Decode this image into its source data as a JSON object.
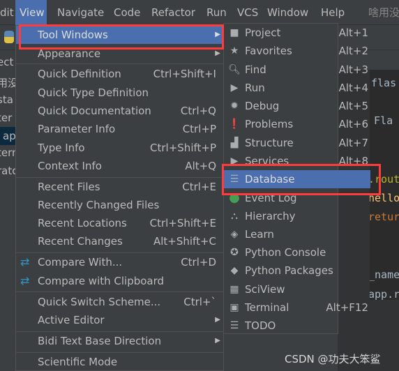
{
  "menubar": {
    "items": [
      {
        "label": "dit"
      },
      {
        "label": "View"
      },
      {
        "label": "Navigate"
      },
      {
        "label": "Code"
      },
      {
        "label": "Refactor"
      },
      {
        "label": "Run"
      },
      {
        "label": "VCS"
      },
      {
        "label": "Window"
      },
      {
        "label": "Help"
      },
      {
        "label": "啥用没"
      }
    ]
  },
  "left_panel": {
    "lines": [
      "ect",
      "用没",
      "sta",
      "ter",
      "ap",
      "tern",
      "rato"
    ]
  },
  "code": {
    "lines": [
      "flas",
      "= Fla",
      ".rout",
      "hello",
      "retur",
      "_name",
      "app.r"
    ]
  },
  "view_menu": {
    "items": [
      {
        "label": "Tool Windows",
        "submenu": true,
        "selected": true
      },
      {
        "label": "Appearance",
        "submenu": true
      },
      {
        "label": "Quick Definition",
        "shortcut": "Ctrl+Shift+I"
      },
      {
        "label": "Quick Type Definition"
      },
      {
        "label": "Quick Documentation",
        "shortcut": "Ctrl+Q"
      },
      {
        "label": "Parameter Info",
        "shortcut": "Ctrl+P"
      },
      {
        "label": "Type Info",
        "shortcut": "Ctrl+Shift+P"
      },
      {
        "label": "Context Info",
        "shortcut": "Alt+Q"
      },
      {
        "label": "Recent Files",
        "shortcut": "Ctrl+E"
      },
      {
        "label": "Recently Changed Files"
      },
      {
        "label": "Recent Locations",
        "shortcut": "Ctrl+Shift+E"
      },
      {
        "label": "Recent Changes",
        "shortcut": "Alt+Shift+C"
      },
      {
        "label": "Compare With...",
        "shortcut": "Ctrl+D",
        "icon": "compare-icon"
      },
      {
        "label": "Compare with Clipboard",
        "icon": "compare-clipboard-icon"
      },
      {
        "label": "Quick Switch Scheme...",
        "shortcut": "Ctrl+`"
      },
      {
        "label": "Active Editor",
        "submenu": true
      },
      {
        "label": "Bidi Text Base Direction",
        "submenu": true
      },
      {
        "label": "Scientific Mode"
      }
    ]
  },
  "tool_windows": {
    "items": [
      {
        "label": "Project",
        "shortcut": "Alt+1",
        "icon": "folder-icon"
      },
      {
        "label": "Favorites",
        "shortcut": "Alt+2",
        "icon": "star-icon"
      },
      {
        "label": "Find",
        "shortcut": "Alt+3",
        "icon": "search-icon"
      },
      {
        "label": "Run",
        "shortcut": "Alt+4",
        "icon": "run-icon"
      },
      {
        "label": "Debug",
        "shortcut": "Alt+5",
        "icon": "bug-icon"
      },
      {
        "label": "Problems",
        "shortcut": "Alt+6",
        "icon": "warning-icon"
      },
      {
        "label": "Structure",
        "shortcut": "Alt+7",
        "icon": "structure-icon"
      },
      {
        "label": "Services",
        "shortcut": "Alt+8",
        "icon": "services-icon"
      },
      {
        "label": "Database",
        "selected": true,
        "icon": "database-icon"
      },
      {
        "label": "Event Log",
        "icon": "event-log-icon"
      },
      {
        "label": "Hierarchy",
        "icon": "hierarchy-icon"
      },
      {
        "label": "Learn",
        "icon": "learn-icon"
      },
      {
        "label": "Python Console",
        "icon": "python-icon"
      },
      {
        "label": "Python Packages",
        "icon": "packages-icon"
      },
      {
        "label": "SciView",
        "icon": "sciview-icon"
      },
      {
        "label": "Terminal",
        "shortcut": "Alt+F12",
        "icon": "terminal-icon"
      },
      {
        "label": "TODO",
        "icon": "todo-icon"
      }
    ]
  },
  "watermark": "CSDN @功夫大笨鲨",
  "colors": {
    "selection": "#4b6eaf",
    "highlight_box": "#ff3b3b",
    "menu_bg": "#3c3f41",
    "event_log": "#499c54"
  }
}
